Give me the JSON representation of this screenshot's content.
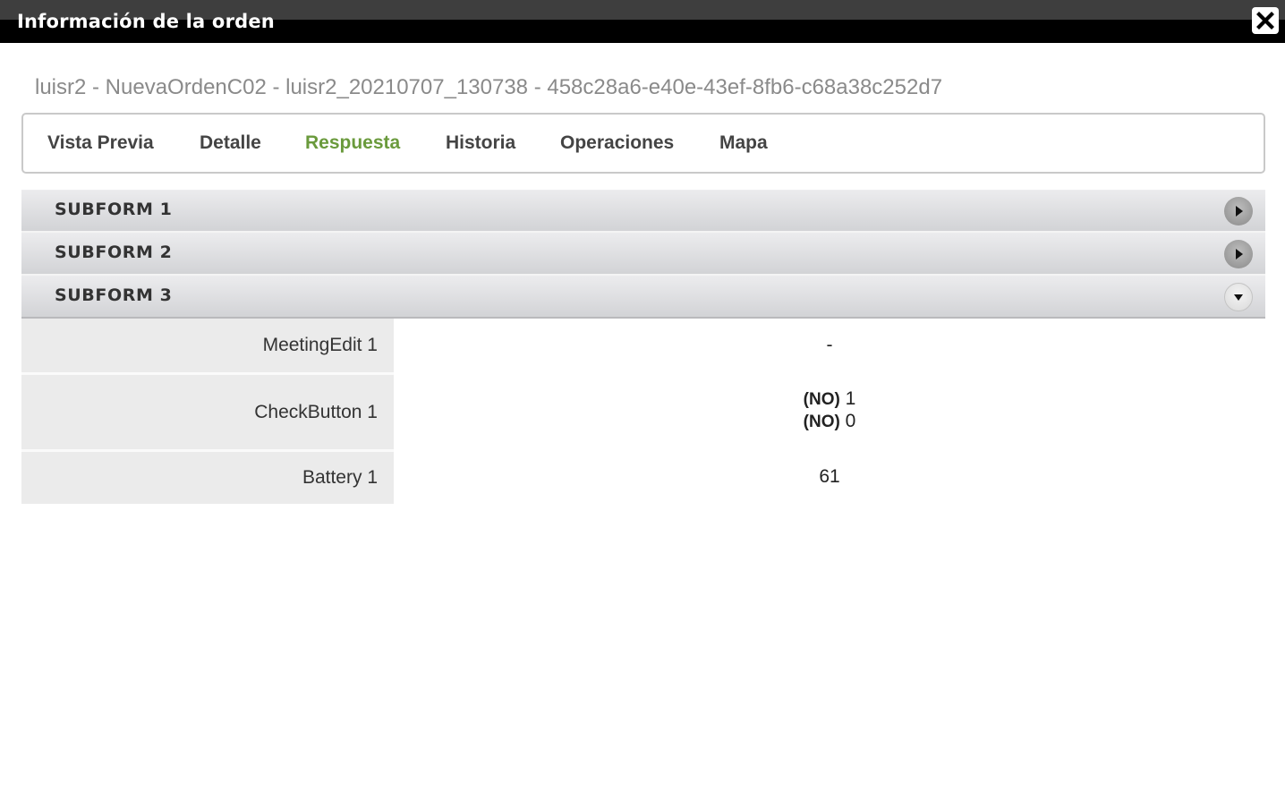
{
  "dialog": {
    "title": "Información de la orden",
    "close_icon": "close-icon"
  },
  "order_header": "luisr2 - NuevaOrdenC02 - luisr2_20210707_130738 - 458c28a6-e40e-43ef-8fb6-c68a38c252d7",
  "tabs": [
    {
      "label": "Vista Previa",
      "active": false
    },
    {
      "label": "Detalle",
      "active": false
    },
    {
      "label": "Respuesta",
      "active": true
    },
    {
      "label": "Historia",
      "active": false
    },
    {
      "label": "Operaciones",
      "active": false
    },
    {
      "label": "Mapa",
      "active": false
    }
  ],
  "accordion": {
    "sections": [
      {
        "title": "SUBFORM 1",
        "expanded": false,
        "icon": "play-right-icon"
      },
      {
        "title": "SUBFORM 2",
        "expanded": false,
        "icon": "play-right-icon"
      },
      {
        "title": "SUBFORM 3",
        "expanded": true,
        "icon": "caret-down-icon"
      }
    ],
    "rows": [
      {
        "label": "MeetingEdit 1",
        "value": "-"
      },
      {
        "label": "CheckButton 1",
        "values": [
          {
            "tag": "(NO)",
            "text": "1"
          },
          {
            "tag": "(NO)",
            "text": "0"
          }
        ]
      },
      {
        "label": "Battery 1",
        "value": "61"
      }
    ]
  },
  "colors": {
    "active_tab": "#6a9a3c",
    "titlebar": "#000000",
    "header_text": "#8a8a8a"
  }
}
